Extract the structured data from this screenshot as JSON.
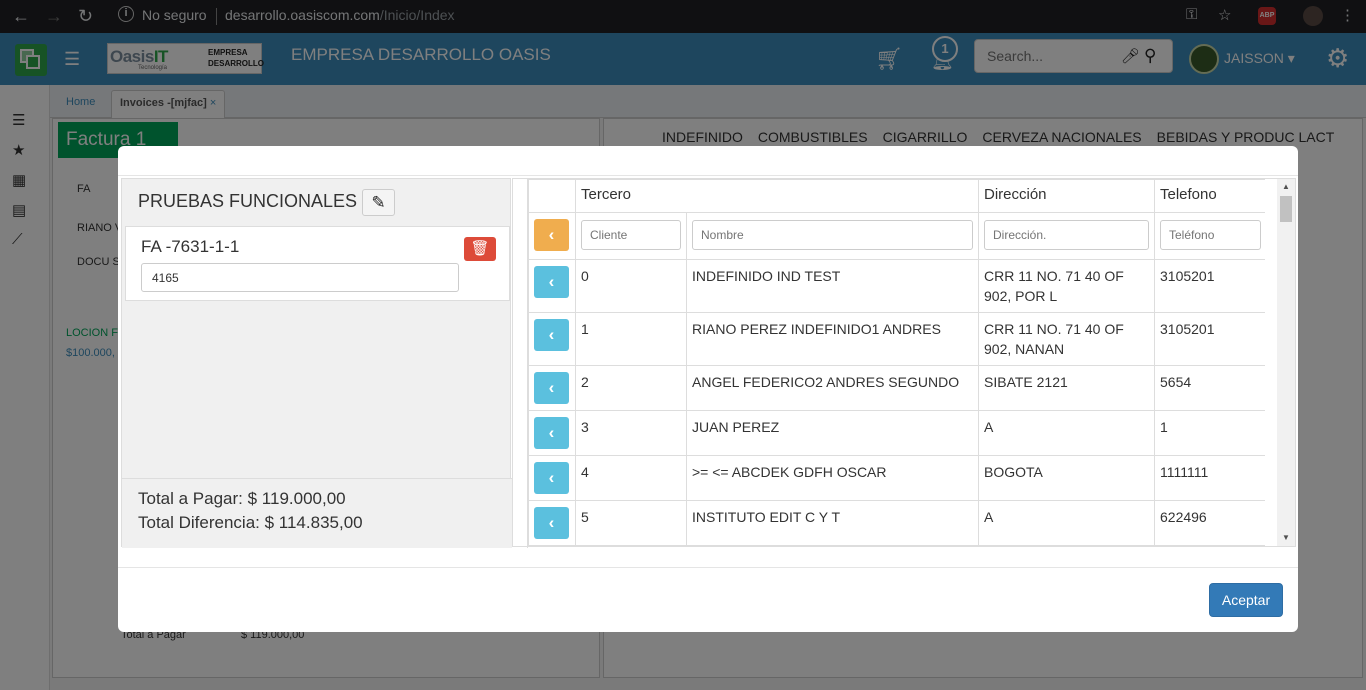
{
  "browser": {
    "security": "No seguro",
    "url_host": "desarrollo.oasiscom.com",
    "url_path": "/Inicio/Index",
    "abp_label": "ABP"
  },
  "topbar": {
    "logo_main": "Oasis",
    "logo_it": "IT",
    "logo_sub": "Tecnología",
    "logo_side": "EMPRESA DESARROLLO",
    "company": "EMPRESA DESARROLLO OASIS",
    "notifications": "1",
    "search_placeholder": "Search...",
    "user": "JAISSON"
  },
  "tabs": {
    "home": "Home",
    "invoices": "Invoices -[mjfac]"
  },
  "background": {
    "factura": "Factura 1",
    "categories": [
      "INDEFINIDO",
      "COMBUSTIBLES",
      "CIGARRILLO",
      "CERVEZA NACIONALES",
      "BEBIDAS Y PRODUC LACT"
    ],
    "fa": "FA",
    "riano": "RIANO V",
    "docu": "DOCU S",
    "locion": "LOCION F",
    "price": "$100.000,",
    "total_pagar_bg": "Total a Pagar",
    "total_val_bg": "$ 119.000,00"
  },
  "left": {
    "title": "PRUEBAS FUNCIONALES",
    "invoice_no": "FA -7631-1-1",
    "amount": "4165",
    "total_pagar": "Total a Pagar: $ 119.000,00",
    "total_diferencia": "Total Diferencia: $ 114.835,00"
  },
  "table": {
    "headers": [
      "Tercero",
      "Dirección",
      "Telefono"
    ],
    "filters": {
      "cliente": "Cliente",
      "nombre": "Nombre",
      "direccion": "Dirección.",
      "telefono": "Teléfono"
    },
    "rows": [
      {
        "id": "0",
        "name": "INDEFINIDO IND TEST",
        "address": "CRR 11 NO. 71 40 OF 902, POR L",
        "phone": "3105201"
      },
      {
        "id": "1",
        "name": "RIANO PEREZ INDEFINIDO1 ANDRES",
        "address": "CRR 11 NO. 71 40 OF 902, NANAN",
        "phone": "3105201"
      },
      {
        "id": "2",
        "name": "ANGEL FEDERICO2 ANDRES SEGUNDO",
        "address": "SIBATE 2121",
        "phone": "5654"
      },
      {
        "id": "3",
        "name": "JUAN PEREZ",
        "address": "A",
        "phone": "1"
      },
      {
        "id": "4",
        "name": ">= <= ABCDEK GDFH OSCAR",
        "address": "BOGOTA",
        "phone": "1111111"
      },
      {
        "id": "5",
        "name": "INSTITUTO EDIT C Y T",
        "address": "A",
        "phone": "622496"
      }
    ]
  },
  "footer": {
    "accept": "Aceptar"
  },
  "colors": {
    "topbar": "#3c8dbc",
    "accept": "#337ab7",
    "select_btn": "#5bc0de",
    "back_btn": "#f0ad4e",
    "delete_btn": "#dd4b39"
  }
}
